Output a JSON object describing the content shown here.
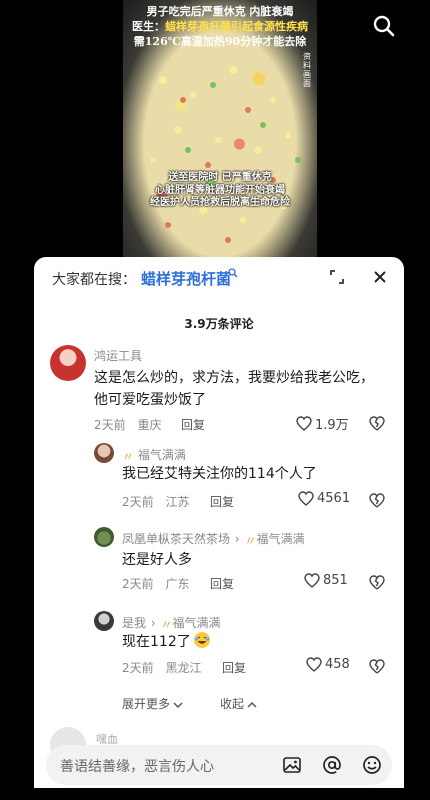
{
  "video": {
    "caption_line1": "男子吃完后严重休克 内脏衰竭",
    "caption_line2_label": "医生：",
    "caption_line2_text": "蜡样芽孢杆菌引起食源性疾病",
    "caption_line3": "需126℃高温加热90分钟才能去除",
    "caption_line4": "送至医院时 已严重休克",
    "caption_line5": "心脏肝肾等脏器功能开始衰竭",
    "caption_line6": "经医护人员抢救后脱离生命危险",
    "side_tag": "资料画面",
    "search_icon": "search-icon"
  },
  "search_bar": {
    "prefix": "大家都在搜：",
    "term": "蜡样芽孢杆菌",
    "colors": {
      "term": "#2f6fd9"
    }
  },
  "comment_count": "3.9万条评论",
  "comments": [
    {
      "user": "鸿运工具",
      "text_lines": [
        "这是怎么炒的，求方法，我要炒给我老公吃，",
        "他可爱吃蛋炒饭了"
      ],
      "time": "2天前",
      "location": "重庆",
      "reply": "回复",
      "likes": "1.9万"
    },
    {
      "user": "福气满满",
      "text_lines": [
        "我已经艾特关注你的114个人了"
      ],
      "time": "2天前",
      "location": "江苏",
      "reply": "回复",
      "likes": "4561"
    },
    {
      "user": "凤凰单枞茶天然茶场",
      "reply_to": "福气满满",
      "text_lines": [
        "还是好人多"
      ],
      "time": "2天前",
      "location": "广东",
      "reply": "回复",
      "likes": "851"
    },
    {
      "user": "是我",
      "reply_to": "福气满满",
      "text_lines": [
        "现在112了"
      ],
      "time": "2天前",
      "location": "黑龙江",
      "reply": "回复",
      "likes": "458"
    }
  ],
  "expand_more": "展开更多",
  "collapse": "收起",
  "next_user": "嘿血",
  "input": {
    "placeholder": "善语结善缘，恶言伤人心"
  }
}
